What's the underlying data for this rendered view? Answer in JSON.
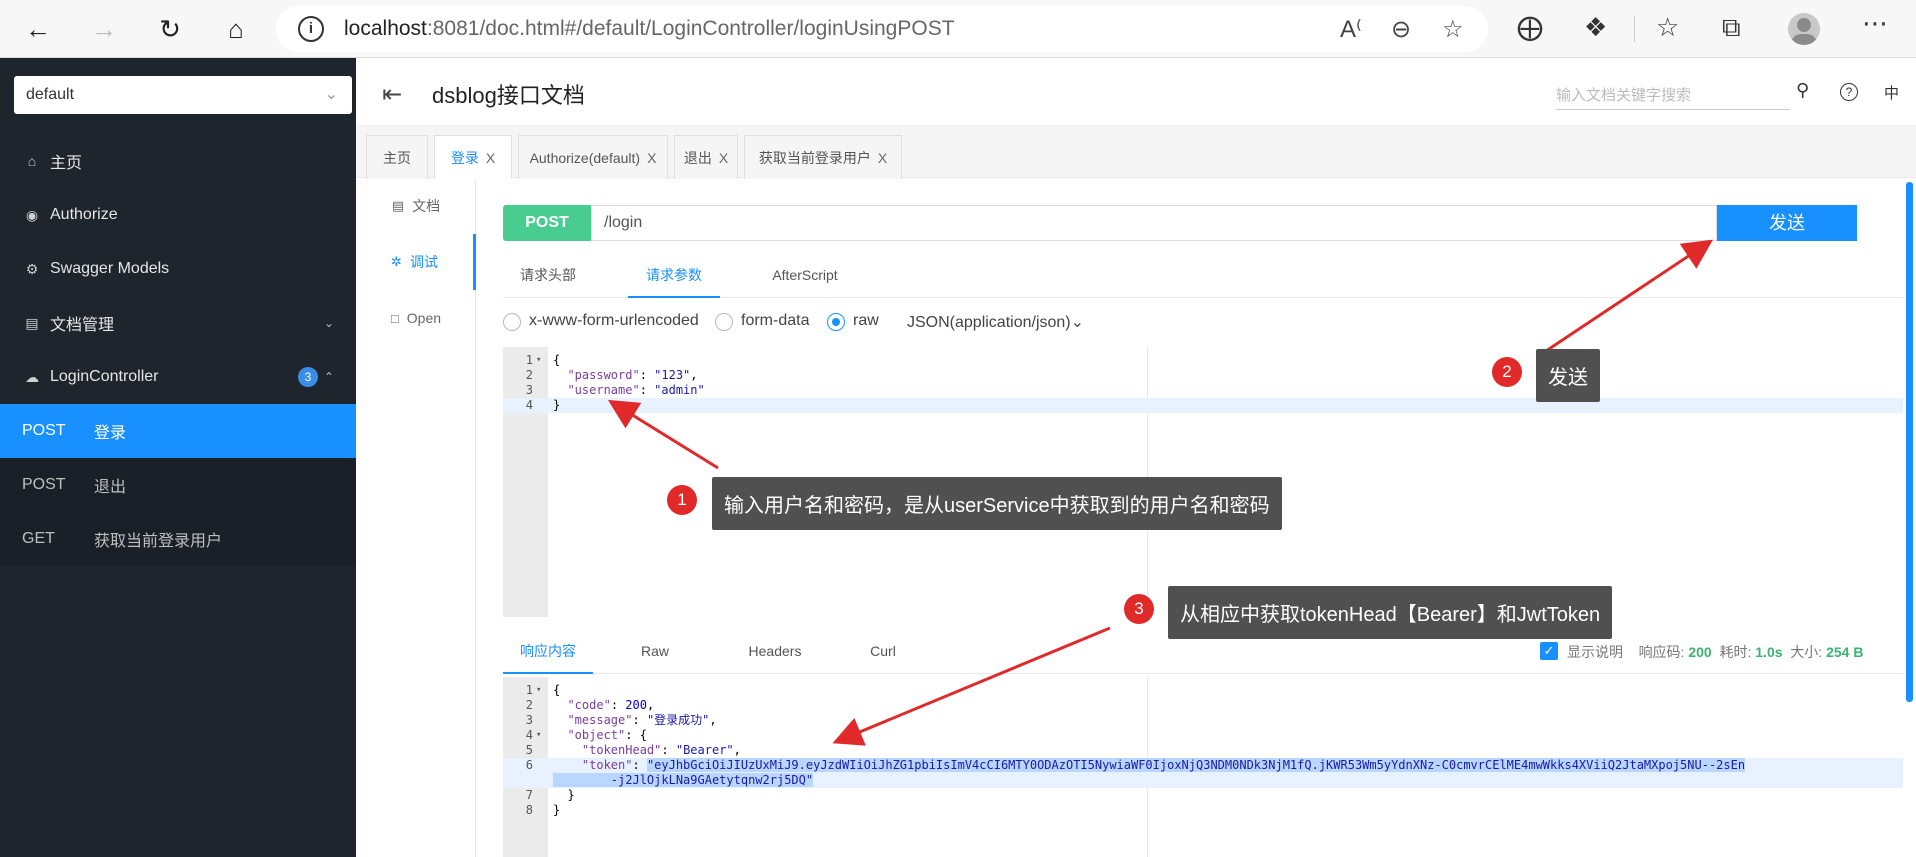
{
  "browser": {
    "url_host": "localhost",
    "url_rest": ":8081/doc.html#/default/LoginController/loginUsingPOST",
    "info_icon": "i"
  },
  "sidebar": {
    "group_select": "default",
    "items": [
      {
        "label": "主页",
        "icon": "home-icon"
      },
      {
        "label": "Authorize",
        "icon": "lock-icon"
      },
      {
        "label": "Swagger Models",
        "icon": "gear-icon"
      },
      {
        "label": "文档管理",
        "icon": "document-icon"
      },
      {
        "label": "LoginController",
        "icon": "cloud-icon",
        "badge": "3"
      }
    ],
    "sub_items": [
      {
        "method": "POST",
        "label": "登录"
      },
      {
        "method": "POST",
        "label": "退出"
      },
      {
        "method": "GET",
        "label": "获取当前登录用户"
      }
    ]
  },
  "header": {
    "title": "dsblog接口文档",
    "search_placeholder": "输入文档关键字搜索",
    "lang": "中"
  },
  "tabs": [
    {
      "label": "主页",
      "closable": false
    },
    {
      "label": "登录",
      "closable": true
    },
    {
      "label": "Authorize(default)",
      "closable": true
    },
    {
      "label": "退出",
      "closable": true
    },
    {
      "label": "获取当前登录用户",
      "closable": true
    }
  ],
  "vtabs": [
    {
      "label": "文档",
      "icon": "document-icon"
    },
    {
      "label": "调试",
      "icon": "bug-icon"
    },
    {
      "label": "Open",
      "icon": "file-icon"
    }
  ],
  "request": {
    "method": "POST",
    "path": "/login",
    "send_label": "发送",
    "tabs": [
      "请求头部",
      "请求参数",
      "AfterScript"
    ],
    "body_types": [
      "x-www-form-urlencoded",
      "form-data",
      "raw"
    ],
    "content_type": "JSON(application/json)",
    "body_lines": [
      {
        "n": "1",
        "fold": true,
        "parts": [
          [
            "p",
            "{"
          ]
        ]
      },
      {
        "n": "2",
        "fold": false,
        "parts": [
          [
            "p",
            "  "
          ],
          [
            "k",
            "\"password\""
          ],
          [
            "p",
            ": "
          ],
          [
            "s",
            "\"123\""
          ],
          [
            "p",
            ","
          ]
        ]
      },
      {
        "n": "3",
        "fold": false,
        "parts": [
          [
            "p",
            "  "
          ],
          [
            "k",
            "\"username\""
          ],
          [
            "p",
            ": "
          ],
          [
            "s",
            "\"admin\""
          ]
        ]
      },
      {
        "n": "4",
        "fold": false,
        "parts": [
          [
            "p",
            "}"
          ]
        ]
      }
    ]
  },
  "response": {
    "tabs": [
      "响应内容",
      "Raw",
      "Headers",
      "Curl"
    ],
    "show_desc": "显示说明",
    "code_label": "响应码:",
    "code": "200",
    "time_label": "耗时:",
    "time": "1.0s",
    "size_label": "大小:",
    "size": "254 B",
    "lines": [
      {
        "n": "1",
        "fold": true,
        "parts": [
          [
            "p",
            "{"
          ]
        ]
      },
      {
        "n": "2",
        "fold": false,
        "parts": [
          [
            "p",
            "  "
          ],
          [
            "k",
            "\"code\""
          ],
          [
            "p",
            ": "
          ],
          [
            "n",
            "200"
          ],
          [
            "p",
            ","
          ]
        ]
      },
      {
        "n": "3",
        "fold": false,
        "parts": [
          [
            "p",
            "  "
          ],
          [
            "k",
            "\"message\""
          ],
          [
            "p",
            ": "
          ],
          [
            "s",
            "\"登录成功\""
          ],
          [
            "p",
            ","
          ]
        ]
      },
      {
        "n": "4",
        "fold": true,
        "parts": [
          [
            "p",
            "  "
          ],
          [
            "k",
            "\"object\""
          ],
          [
            "p",
            ": {"
          ]
        ]
      },
      {
        "n": "5",
        "fold": false,
        "parts": [
          [
            "p",
            "    "
          ],
          [
            "k",
            "\"tokenHead\""
          ],
          [
            "p",
            ": "
          ],
          [
            "s",
            "\"Bearer\""
          ],
          [
            "p",
            ","
          ]
        ]
      },
      {
        "n": "6",
        "fold": false,
        "parts": [
          [
            "p",
            "    "
          ],
          [
            "k",
            "\"token\""
          ],
          [
            "p",
            ": "
          ],
          [
            "x",
            "\"eyJhbGciOiJIUzUxMiJ9.eyJzdWIiOiJhZG1pbiIsImV4cCI6MTY0ODAzOTI5NywiaWF0IjoxNjQ3NDM0NDk3NjM1fQ.jKWR53Wm5yYdnXNz-C0cmvrCElME4mwWkks4XViiQ2JtaMXpoj5NU--2sEn"
          ]
        ]
      },
      {
        "n": "",
        "fold": false,
        "parts": [
          [
            "x",
            "        -j2JlOjkLNa9GAetytqnw2rj5DQ\""
          ]
        ]
      },
      {
        "n": "7",
        "fold": false,
        "parts": [
          [
            "p",
            "  }"
          ]
        ]
      },
      {
        "n": "8",
        "fold": false,
        "parts": [
          [
            "p",
            "}"
          ]
        ]
      }
    ]
  },
  "annotations": [
    {
      "num": "1",
      "text": "输入用户名和密码，是从userService中获取到的用户名和密码"
    },
    {
      "num": "2",
      "text": "发送"
    },
    {
      "num": "3",
      "text": "从相应中获取tokenHead【Bearer】和JwtToken"
    }
  ],
  "colors": {
    "accent": "#1890ff",
    "post": "#49cc90",
    "sidebar": "#1e252d",
    "annotation_red": "#e02a2a"
  }
}
